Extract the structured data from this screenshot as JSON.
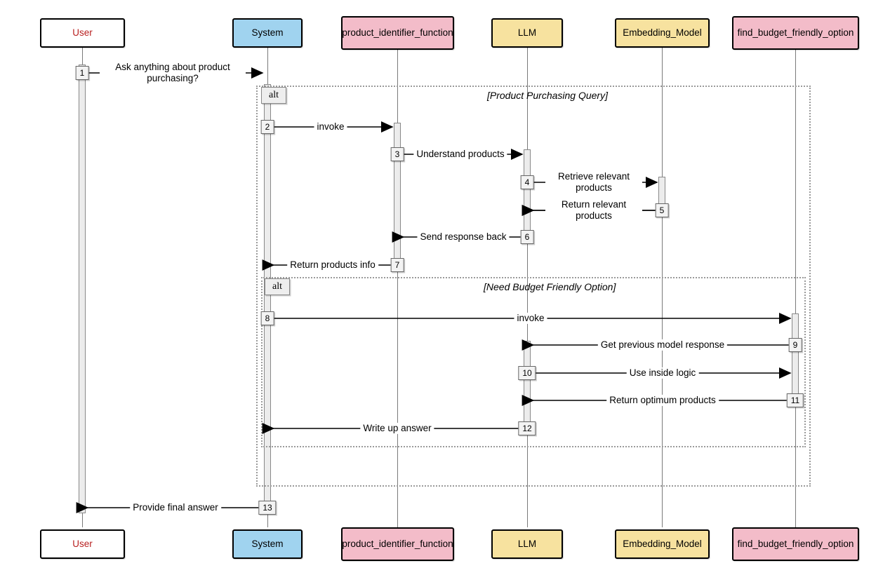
{
  "participants": {
    "user": "User",
    "system": "System",
    "pif": "product_identifier_function",
    "llm": "LLM",
    "emb": "Embedding_Model",
    "fbfo": "find_budget_friendly_option"
  },
  "alt": {
    "label1": "alt",
    "guard1": "[Product Purchasing Query]",
    "label2": "alt",
    "guard2": "[Need Budget Friendly Option]"
  },
  "steps": {
    "s1": "1",
    "s2": "2",
    "s3": "3",
    "s4": "4",
    "s5": "5",
    "s6": "6",
    "s7": "7",
    "s8": "8",
    "s9": "9",
    "s10": "10",
    "s11": "11",
    "s12": "12",
    "s13": "13"
  },
  "messages": {
    "m1": "Ask anything about product purchasing?",
    "m2": "invoke",
    "m3": "Understand products",
    "m4": "Retrieve relevant products",
    "m5": "Return relevant products",
    "m6": "Send response back",
    "m7": "Return products info",
    "m8": "invoke",
    "m9": "Get previous model response",
    "m10": "Use inside logic",
    "m11": "Return optimum products",
    "m12": "Write up answer",
    "m13": "Provide final answer"
  },
  "chart_data": {
    "type": "sequence_diagram",
    "participants": [
      {
        "id": "User",
        "style": "user"
      },
      {
        "id": "System",
        "style": "system"
      },
      {
        "id": "product_identifier_function",
        "style": "pink"
      },
      {
        "id": "LLM",
        "style": "yellow"
      },
      {
        "id": "Embedding_Model",
        "style": "yellow"
      },
      {
        "id": "find_budget_friendly_option",
        "style": "pink"
      }
    ],
    "fragments": [
      {
        "type": "alt",
        "guard": "[Product Purchasing Query]",
        "covers": [
          "System",
          "product_identifier_function",
          "LLM",
          "Embedding_Model",
          "find_budget_friendly_option"
        ],
        "messages": [
          {
            "n": 2,
            "from": "System",
            "to": "product_identifier_function",
            "label": "invoke"
          },
          {
            "n": 3,
            "from": "product_identifier_function",
            "to": "LLM",
            "label": "Understand products"
          },
          {
            "n": 4,
            "from": "LLM",
            "to": "Embedding_Model",
            "label": "Retrieve relevant products"
          },
          {
            "n": 5,
            "from": "Embedding_Model",
            "to": "LLM",
            "label": "Return relevant products"
          },
          {
            "n": 6,
            "from": "LLM",
            "to": "product_identifier_function",
            "label": "Send response back"
          },
          {
            "n": 7,
            "from": "product_identifier_function",
            "to": "System",
            "label": "Return products info"
          }
        ],
        "inner_alt": {
          "type": "alt",
          "guard": "[Need Budget Friendly Option]",
          "messages": [
            {
              "n": 8,
              "from": "System",
              "to": "find_budget_friendly_option",
              "label": "invoke"
            },
            {
              "n": 9,
              "from": "find_budget_friendly_option",
              "to": "LLM",
              "label": "Get previous model response"
            },
            {
              "n": 10,
              "from": "LLM",
              "to": "find_budget_friendly_option",
              "label": "Use inside logic"
            },
            {
              "n": 11,
              "from": "find_budget_friendly_option",
              "to": "LLM",
              "label": "Return optimum products"
            },
            {
              "n": 12,
              "from": "LLM",
              "to": "System",
              "label": "Write up answer"
            }
          ]
        }
      }
    ],
    "outer_messages": [
      {
        "n": 1,
        "from": "User",
        "to": "System",
        "label": "Ask anything about product purchasing?"
      },
      {
        "n": 13,
        "from": "System",
        "to": "User",
        "label": "Provide final answer"
      }
    ]
  }
}
